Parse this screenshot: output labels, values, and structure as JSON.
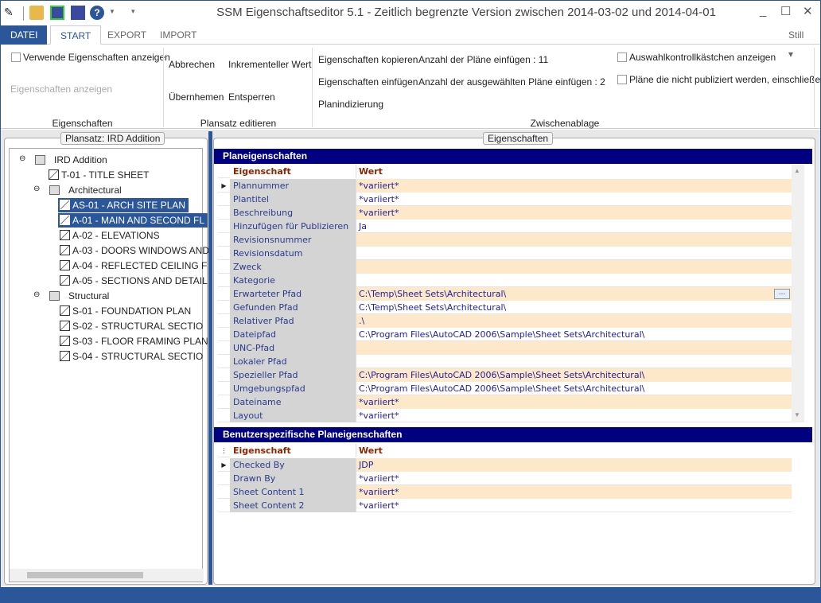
{
  "window": {
    "title": "SSM Eigenschaftseditor 5.1 - Zeitlich begrenzte Version zwischen 2014-03-02 und 2014-04-01",
    "minimize": "_",
    "maximize": "☐",
    "close": "✕"
  },
  "quick_access": [
    "app-icon",
    "open-icon",
    "save-check-icon",
    "save-icon",
    "help-icon"
  ],
  "tabs": {
    "datei": "DATEI",
    "start": "START",
    "export": "EXPORT",
    "import": "IMPORT",
    "style": "Still ▾"
  },
  "ribbon": {
    "eigenschaften": {
      "show_used": "Verwende Eigenschaften anzeigen",
      "show_props": "Eigenschaften anzeigen",
      "group": "Eigenschaften"
    },
    "plansatz": {
      "abbrechen": "Abbrechen",
      "inkrementell": "Inkrementeller Wert",
      "uebernehmen": "Übernhemen",
      "entsperren": "Entsperren",
      "group": "Plansatz editieren"
    },
    "zwischenablage": {
      "kopieren": "Eigenschaften kopieren",
      "einfuegen": "Eigenschaften einfügen",
      "indizierung": "Planindizierung",
      "anzahl_plaene": "Anzahl der Pläne einfügen : 11",
      "anzahl_ausgewaehlt": "Anzahl der ausgewählten Pläne einfügen : 2",
      "group": "Zwischenablage"
    },
    "options": {
      "auswahl": "Auswahlkontrollkästchen anzeigen",
      "nicht_publiziert": "Pläne die nicht publiziert werden, einschließen"
    }
  },
  "tree": {
    "legend": "Plansatz: IRD Addition",
    "nodes": [
      {
        "label": "IRD Addition",
        "level": 0,
        "type": "set",
        "expanded": true
      },
      {
        "label": "T-01 - TITLE SHEET",
        "level": 1,
        "type": "sheet"
      },
      {
        "label": "Architectural",
        "level": 1,
        "type": "subset",
        "expanded": true
      },
      {
        "label": "AS-01 - ARCH SITE PLAN",
        "level": 2,
        "type": "sheet",
        "selected": true
      },
      {
        "label": "A-01 - MAIN AND SECOND FL",
        "level": 2,
        "type": "sheet",
        "selected": true
      },
      {
        "label": "A-02 - ELEVATIONS",
        "level": 2,
        "type": "sheet"
      },
      {
        "label": "A-03 - DOORS WINDOWS AND",
        "level": 2,
        "type": "sheet"
      },
      {
        "label": "A-04 - REFLECTED CEILING F",
        "level": 2,
        "type": "sheet"
      },
      {
        "label": "A-05 - SECTIONS AND DETAIL",
        "level": 2,
        "type": "sheet"
      },
      {
        "label": "Structural",
        "level": 1,
        "type": "subset",
        "expanded": true
      },
      {
        "label": "S-01 - FOUNDATION PLAN",
        "level": 2,
        "type": "sheet"
      },
      {
        "label": "S-02 - STRUCTURAL SECTIO",
        "level": 2,
        "type": "sheet"
      },
      {
        "label": "S-03 - FLOOR FRAMING PLAN",
        "level": 2,
        "type": "sheet"
      },
      {
        "label": "S-04 - STRUCTURAL SECTIO",
        "level": 2,
        "type": "sheet"
      }
    ]
  },
  "props": {
    "legend": "Eigenschaften",
    "sheet": {
      "title": "Planeigenschaften",
      "col_prop": "Eigenschaft",
      "col_val": "Wert",
      "rows": [
        [
          "Plannummer",
          "*variiert*"
        ],
        [
          "Plantitel",
          "*variiert*"
        ],
        [
          "Beschreibung",
          "*variiert*"
        ],
        [
          "Hinzufügen für Publizieren",
          "Ja"
        ],
        [
          "Revisionsnummer",
          ""
        ],
        [
          "Revisionsdatum",
          ""
        ],
        [
          "Zweck",
          ""
        ],
        [
          "Kategorie",
          ""
        ],
        [
          "Erwarteter Pfad",
          "C:\\Temp\\Sheet Sets\\Architectural\\"
        ],
        [
          "Gefunden Pfad",
          "C:\\Temp\\Sheet Sets\\Architectural\\"
        ],
        [
          "Relativer Pfad",
          ".\\"
        ],
        [
          "Dateipfad",
          "C:\\Program Files\\AutoCAD 2006\\Sample\\Sheet Sets\\Architectural\\"
        ],
        [
          "UNC-Pfad",
          ""
        ],
        [
          "Lokaler Pfad",
          ""
        ],
        [
          "Spezieller Pfad",
          "C:\\Program Files\\AutoCAD 2006\\Sample\\Sheet Sets\\Architectural\\"
        ],
        [
          "Umgebungspfad",
          "C:\\Program Files\\AutoCAD 2006\\Sample\\Sheet Sets\\Architectural\\"
        ],
        [
          "Dateiname",
          "*variiert*"
        ],
        [
          "Layout",
          "*variiert*"
        ]
      ],
      "browse": "..."
    },
    "custom": {
      "title": "Benutzerspezifische Planeigenschaften",
      "col_prop": "Eigenschaft",
      "col_val": "Wert",
      "rows": [
        [
          "Checked By",
          "JDP"
        ],
        [
          "Drawn By",
          "*variiert*"
        ],
        [
          "Sheet Content 1",
          "*variiert*"
        ],
        [
          "Sheet Content 2",
          "*variiert*"
        ]
      ]
    }
  },
  "colors": {
    "accent": "#2b579a",
    "grid_header": "#000080",
    "alt_row": "#fde9c9"
  }
}
